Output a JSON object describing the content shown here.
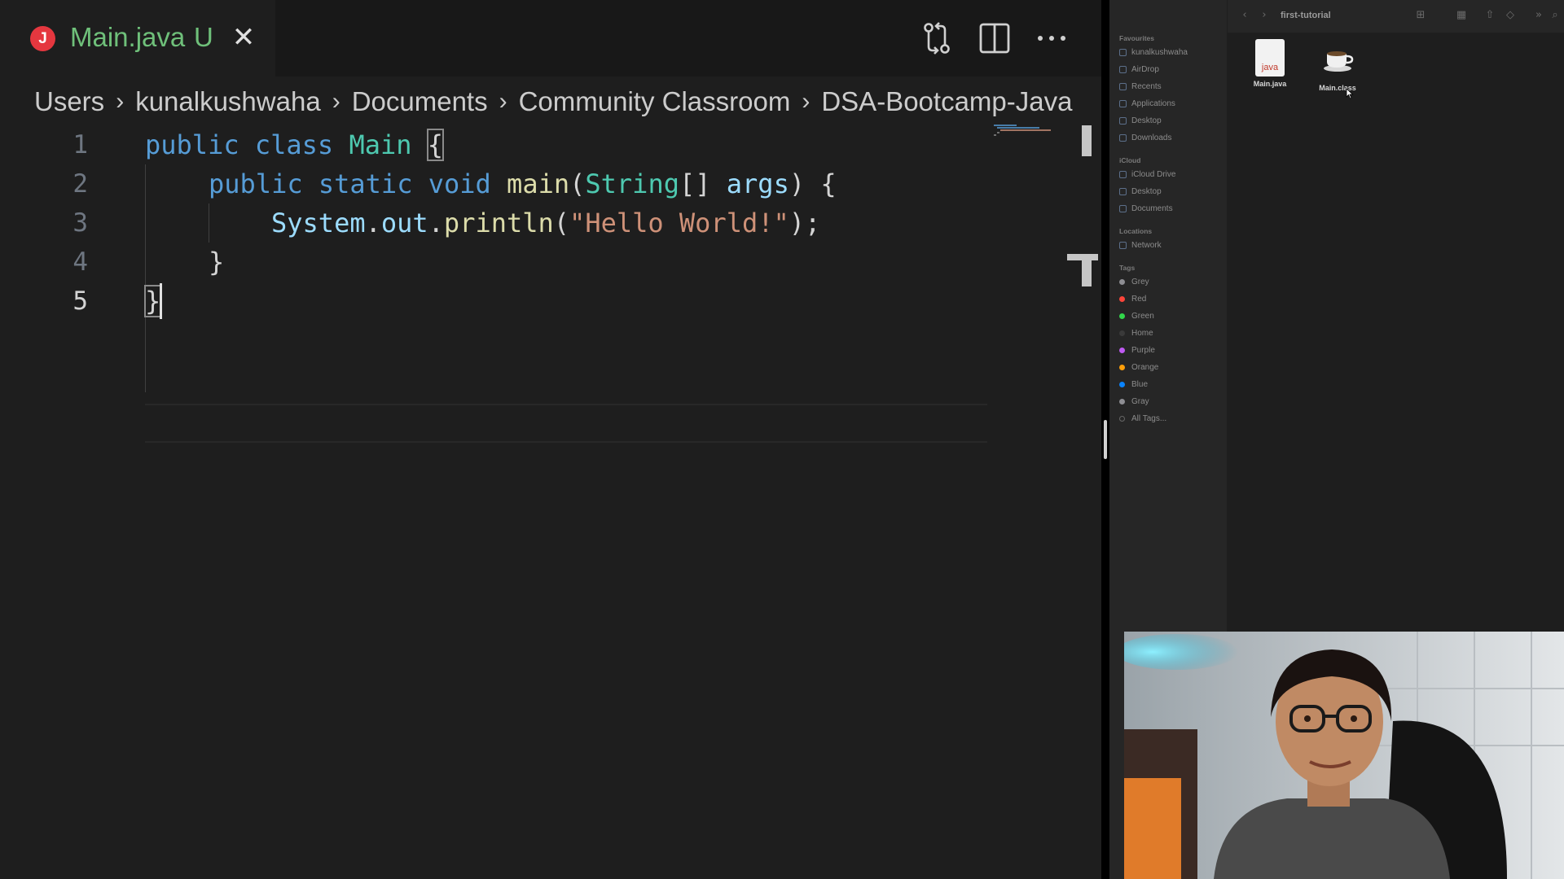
{
  "editor": {
    "tab": {
      "icon_letter": "J",
      "title": "Main.java",
      "status": "U",
      "close_glyph": "✕"
    },
    "toolbar_icons": [
      "compare-changes-icon",
      "split-editor-icon",
      "more-actions-icon"
    ],
    "breadcrumb": [
      "Users",
      "kunalkushwaha",
      "Documents",
      "Community Classroom",
      "DSA-Bootcamp-Java"
    ],
    "breadcrumb_separator": "›",
    "line_numbers": [
      "1",
      "2",
      "3",
      "4",
      "5"
    ],
    "code": {
      "l1": {
        "kw1": "public",
        "kw2": "class",
        "name": "Main",
        "brace": "{"
      },
      "l2": {
        "kw1": "public",
        "kw2": "static",
        "kw3": "void",
        "fn": "main",
        "paren_open": "(",
        "type": "String",
        "arr": "[]",
        "arg": "args",
        "rest": ") {"
      },
      "l3": {
        "obj": "System",
        "dot1": ".",
        "field": "out",
        "dot2": ".",
        "fn": "println",
        "paren_open": "(",
        "str": "\"Hello World!\"",
        "rest": ");"
      },
      "l4": {
        "brace": "}"
      },
      "l5": {
        "brace": "}"
      }
    },
    "active_line": "5",
    "colors": {
      "background": "#1e1e1e",
      "tab_title": "#6fc07a",
      "keyword": "#569cd6",
      "type": "#4ec9b0",
      "function": "#dcdcaa",
      "variable": "#9cdcfe",
      "string": "#ce9178",
      "java_badge": "#e5373f"
    }
  },
  "finder": {
    "title": "first-tutorial",
    "sidebar": {
      "favourites_header": "Favourites",
      "favourites": [
        "kunalkushwaha",
        "AirDrop",
        "Recents",
        "Applications",
        "Desktop",
        "Downloads"
      ],
      "icloud_header": "iCloud",
      "icloud": [
        "iCloud Drive",
        "Desktop",
        "Documents"
      ],
      "locations_header": "Locations",
      "locations": [
        "Network"
      ],
      "tags_header": "Tags",
      "tags": [
        {
          "label": "Grey",
          "color": "#8e8e93"
        },
        {
          "label": "Red",
          "color": "#ff453a"
        },
        {
          "label": "Green",
          "color": "#32d74b"
        },
        {
          "label": "Home",
          "color": "#3a3a3a"
        },
        {
          "label": "Purple",
          "color": "#bf5af2"
        },
        {
          "label": "Orange",
          "color": "#ff9f0a"
        },
        {
          "label": "Blue",
          "color": "#0a84ff"
        },
        {
          "label": "Gray",
          "color": "#8e8e93"
        },
        {
          "label": "All Tags...",
          "color": ""
        }
      ]
    },
    "files": [
      {
        "name": "Main.java",
        "icon": "java-document-icon",
        "badge": "java"
      },
      {
        "name": "Main.class",
        "icon": "coffee-cup-icon"
      }
    ]
  },
  "webcam": {
    "content": "presenter-webcam-feed"
  }
}
